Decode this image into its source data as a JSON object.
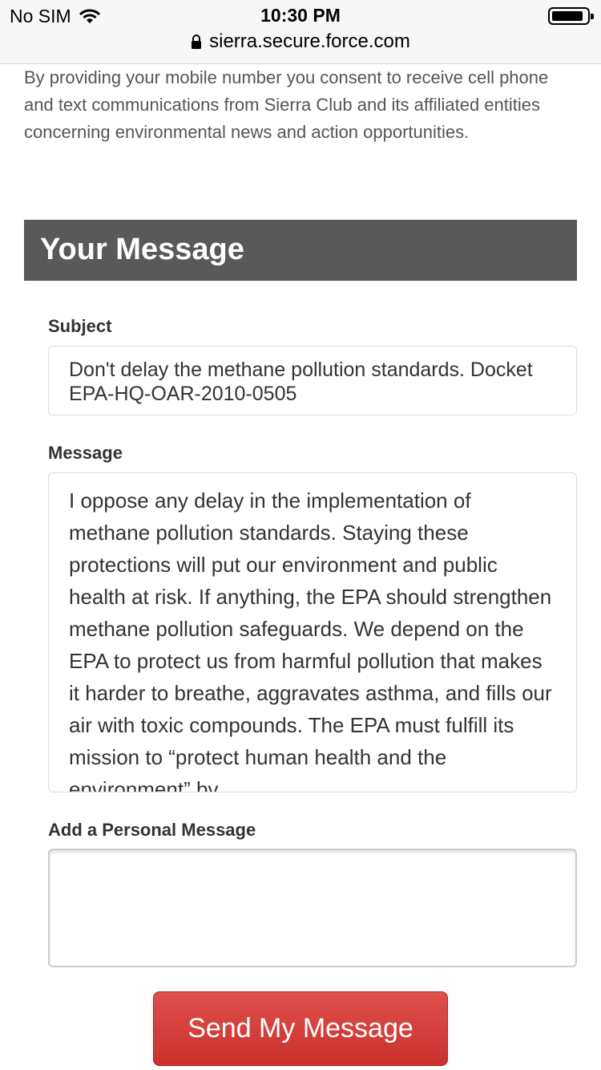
{
  "status_bar": {
    "carrier": "No SIM",
    "time": "10:30 PM",
    "url": "sierra.secure.force.com"
  },
  "consent_text": "By providing your mobile number you consent to receive cell phone and text communications from Sierra Club and its affiliated entities concerning environmental news and action opportunities.",
  "section": {
    "title": "Your Message"
  },
  "form": {
    "subject_label": "Subject",
    "subject_value": "Don't delay the methane pollution standards. Docket EPA-HQ-OAR-2010-0505",
    "message_label": "Message",
    "message_value": "I oppose any delay in the implementation of methane pollution standards. Staying these protections will put our environment and public health at risk. If anything, the EPA should strengthen methane pollution safeguards. We depend on the EPA to protect us from harmful pollution that makes it harder to breathe, aggravates asthma, and fills our air with toxic compounds. The EPA must fulfill its mission to “protect human health and the environment” by",
    "personal_label": "Add a Personal Message",
    "personal_value": "",
    "submit_label": "Send My Message"
  },
  "colors": {
    "header_bg": "#595959",
    "button_red": "#d9534f"
  }
}
